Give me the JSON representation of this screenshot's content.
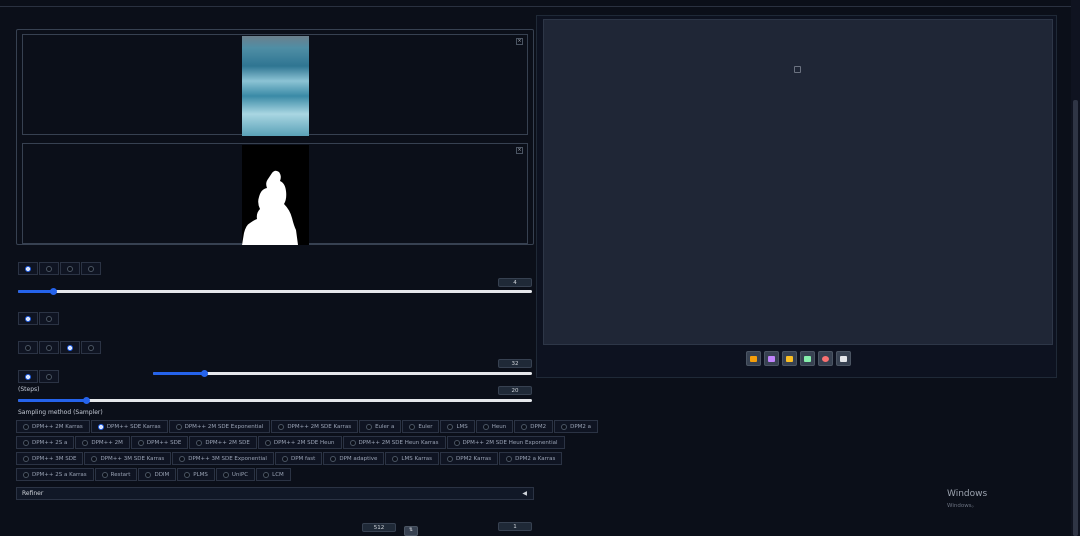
{
  "img2img_tabs": [],
  "inpaint": {
    "mask_blur": 4,
    "mask_padding": 32
  },
  "sampling": {
    "label": "Sampling method (Sampler)",
    "steps_label": "(Steps)",
    "steps": 20,
    "samplers": [
      [
        "DPM++ 2M Karras",
        "DPM++ SDE Karras",
        "DPM++ 2M SDE Exponential",
        "DPM++ 2M SDE Karras",
        "Euler a",
        "Euler",
        "LMS",
        "Heun",
        "DPM2",
        "DPM2 a"
      ],
      [
        "DPM++ 2S a",
        "DPM++ 2M",
        "DPM++ SDE",
        "DPM++ 2M SDE",
        "DPM++ 2M SDE Heun",
        "DPM++ 2M SDE Heun Karras",
        "DPM++ 2M SDE Heun Exponential"
      ],
      [
        "DPM++ 3M SDE",
        "DPM++ 3M SDE Karras",
        "DPM++ 3M SDE Exponential",
        "DPM fast",
        "DPM adaptive",
        "LMS Karras",
        "DPM2 Karras",
        "DPM2 a Karras"
      ],
      [
        "DPM++ 2S a Karras",
        "Restart",
        "DDIM",
        "PLMS",
        "UniPC",
        "LCM"
      ]
    ],
    "selected": "DPM++ SDE Karras"
  },
  "refiner": {
    "label": "Refiner",
    "arrow": "◀"
  },
  "size_tabs": [],
  "size": {
    "width": 512
  },
  "batch": {
    "count": 1
  },
  "watermark": {
    "title": "Windows",
    "subtitle": "Windows。"
  },
  "colors": {
    "accent": "#2563eb",
    "background": "#0b0f19",
    "panel": "#1f2636"
  },
  "output_tools": [
    "folder-icon",
    "save-icon",
    "zip-icon",
    "img2img-icon",
    "inpaint-icon",
    "extras-icon"
  ]
}
